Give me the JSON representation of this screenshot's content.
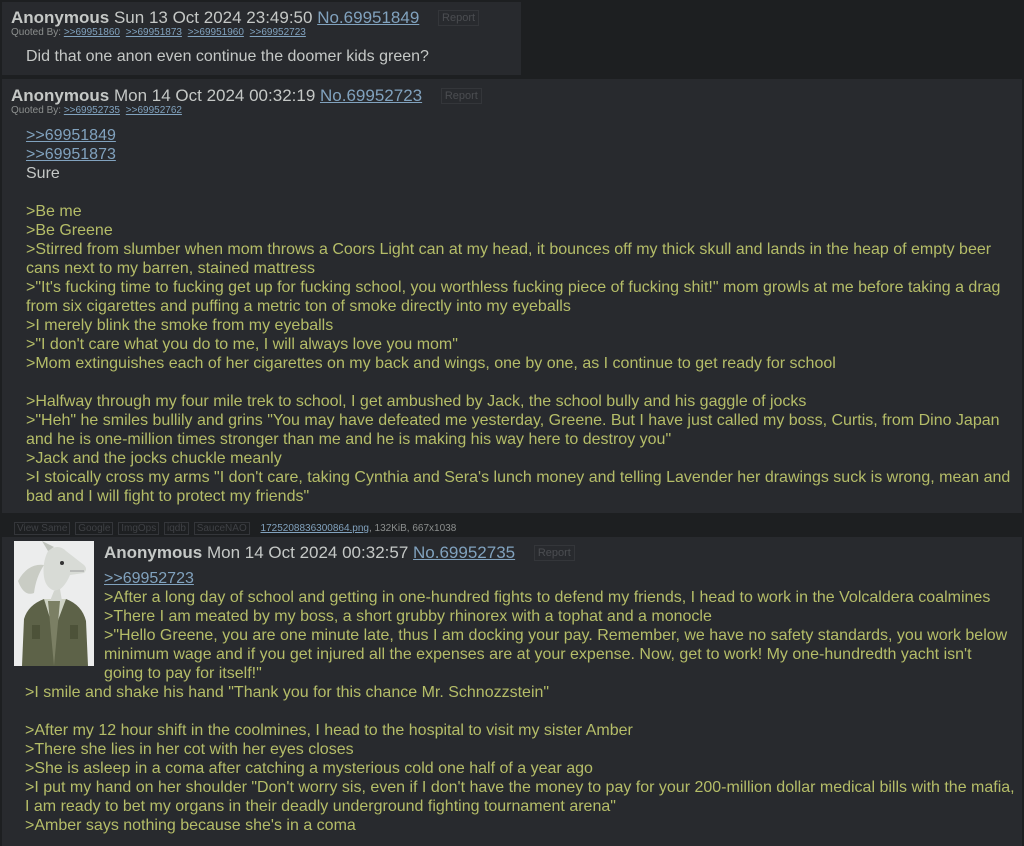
{
  "post1": {
    "name": "Anonymous",
    "date": "Sun 13 Oct 2024 23:49:50",
    "number": "No.69951849",
    "report": "Report",
    "quoted_by_label": "Quoted By:",
    "quoted_by": [
      ">>69951860",
      ">>69951873",
      ">>69951960",
      ">>69952723"
    ],
    "text": "Did that one anon even continue the doomer kids green?"
  },
  "post2": {
    "name": "Anonymous",
    "date": "Mon 14 Oct 2024 00:32:19",
    "number": "No.69952723",
    "report": "Report",
    "quoted_by_label": "Quoted By:",
    "quoted_by": [
      ">>69952735",
      ">>69952762"
    ],
    "lines": [
      ">>69951849",
      ">>69951873",
      "Sure",
      "",
      ">Be me",
      ">Be Greene",
      ">Stirred from slumber when mom throws a Coors Light can at my head, it bounces off my thick skull and lands in the heap of empty beer",
      "cans next to my barren, stained mattress",
      ">\"It's fucking time to fucking get up for fucking school, you worthless fucking piece of fucking shit!\" mom growls at me before taking a drag",
      "from six cigarettes and puffing a metric ton of smoke directly into my eyeballs",
      ">I merely blink the smoke from my eyeballs",
      ">\"I don't care what you do to me, I will always love you mom\"",
      ">Mom extinguishes each of her cigarettes on my back and wings, one by one, as I continue to get ready for school",
      "",
      ">Halfway through my four mile trek to school, I get ambushed by Jack, the school bully and his gaggle of jocks",
      ">\"Heh\" he smiles bullily and grins \"You may have defeated me yesterday, Greene. But I have just called my boss, Curtis, from Dino Japan",
      "and he is one-million times stronger than me and he is making his way here to destroy you\"",
      ">Jack and the jocks chuckle meanly",
      ">I stoically cross my arms \"I don't care, taking Cynthia and Sera's lunch money and telling Lavender her drawings suck is wrong, mean and",
      "bad and I will fight to protect my friends\""
    ],
    "line_types": [
      "ql",
      "ql",
      "plain",
      "plain",
      "gt",
      "gt",
      "gt",
      "gt",
      "gt",
      "gt",
      "gt",
      "gt",
      "gt",
      "plain",
      "gt",
      "gt",
      "gt",
      "gt",
      "gt",
      "gt"
    ]
  },
  "post3": {
    "file_tools": [
      "View Same",
      "Google",
      "ImgOps",
      "iqdb",
      "SauceNAO"
    ],
    "file_name": "1725208836300864.png",
    "file_info": ", 132KiB, 667x1038",
    "name": "Anonymous",
    "date": "Mon 14 Oct 2024 00:32:57",
    "number": "No.69952735",
    "report": "Report",
    "lines_right": [
      ">>69952723",
      ">After a long day of school and getting in one-hundred fights to defend my friends, I head to work in the Volcaldera coalmines",
      ">There I am meated by my boss, a short grubby rhinorex with a tophat and a monocle",
      ">\"Hello Greene, you are one minute late, thus I am docking your pay. Remember, we have no safety standards, you work below",
      "minimum wage and if you get injured all the expenses are at your expense. Now, get to work! My one-hundredth yacht isn't",
      "going to pay for itself!\""
    ],
    "line_types_right": [
      "ql",
      "gt",
      "gt",
      "gt",
      "gt",
      "gt"
    ],
    "lines_full": [
      ">I smile and shake his hand \"Thank you for this chance Mr. Schnozzstein\"",
      "",
      ">After my 12 hour shift in the coolmines, I head to the hospital to visit my sister Amber",
      ">There she lies in her cot with her eyes closes",
      ">She is asleep in a coma after catching a mysterious cold one half of a year ago",
      ">I put my hand on her shoulder \"Don't worry sis, even if I don't have the money to pay for your 200-million dollar medical bills with the mafia,",
      "I am ready to bet my organs in their deadly underground fighting tournament arena\"",
      ">Amber says nothing because she's in a coma"
    ],
    "line_types_full": [
      "gt",
      "plain",
      "gt",
      "gt",
      "gt",
      "gt",
      "gt",
      "gt"
    ]
  }
}
